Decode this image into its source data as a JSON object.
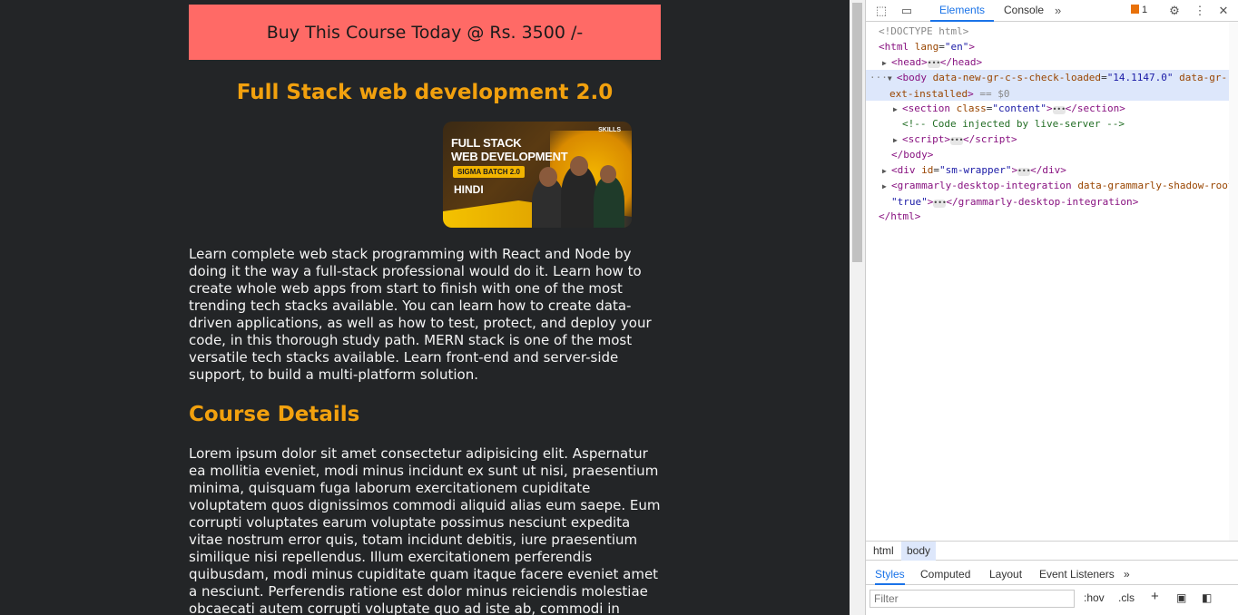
{
  "page": {
    "buy_button_label": "Buy This Course Today @ Rs. 3500 /-",
    "course_title": "Full Stack web development 2.0",
    "thumbnail": {
      "line1": "FULL STACK",
      "line2": "WEB DEVELOPMENT",
      "batch": "SIGMA BATCH 2.0",
      "language": "HINDI",
      "brand": "SKILLS"
    },
    "intro_text": "Learn complete web stack programming with React and Node by doing it the way a full-stack professional would do it. Learn how to create whole web apps from start to finish with one of the most trending tech stacks available. You can learn how to create data-driven applications, as well as how to test, protect, and deploy your code, in this thorough study path. MERN stack is one of the most versatile tech stacks available. Learn front-end and server-side support, to build a multi-platform solution.",
    "details_heading": "Course Details",
    "details_text": "Lorem ipsum dolor sit amet consectetur adipisicing elit. Aspernatur ea mollitia eveniet, modi minus incidunt ex sunt ut nisi, praesentium minima, quisquam fuga laborum exercitationem cupiditate voluptatem quos dignissimos commodi aliquid alias eum saepe. Eum corrupti voluptates earum voluptate possimus nesciunt expedita vitae nostrum error quis, totam incidunt debitis, iure praesentium similique nisi repellendus. Illum exercitationem perferendis quibusdam, modi minus cupiditate quam itaque facere eveniet amet a nesciunt. Perferendis ratione est dolor minus reiciendis molestiae obcaecati autem corrupti voluptate quo ad iste ab, commodi in voluptatum fuga pariatur minima"
  },
  "devtools": {
    "tabs": {
      "elements": "Elements",
      "console": "Console",
      "more": "»"
    },
    "issues_count": "1",
    "tree": {
      "doctype": "<!DOCTYPE html>",
      "html_open_tag": "<html",
      "html_lang_attr": "lang",
      "html_lang_val": "\"en\"",
      "head": "head",
      "body_tag": "body",
      "body_attr1": "data-new-gr-c-s-check-loaded",
      "body_val1": "\"14.1147.0\"",
      "body_attr2": "data-gr-",
      "body_attr2_cont": "ext-installed",
      "body_selected_marker": "== $0",
      "section_tag": "section",
      "section_attr": "class",
      "section_val": "\"content\"",
      "comment": "<!-- Code injected by live-server -->",
      "script_tag": "script",
      "body_close": "</body>",
      "div_tag": "div",
      "div_attr": "id",
      "div_val": "\"sm-wrapper\"",
      "grammarly_tag": "grammarly-desktop-integration",
      "grammarly_attr": "data-grammarly-shadow-root=",
      "grammarly_val": "\"true\"",
      "html_close": "</html>"
    },
    "breadcrumbs": [
      "html",
      "body"
    ],
    "subtabs": [
      "Styles",
      "Computed",
      "Layout",
      "Event Listeners",
      "»"
    ],
    "filter_placeholder": "Filter",
    "hov": ":hov",
    "cls": ".cls"
  }
}
